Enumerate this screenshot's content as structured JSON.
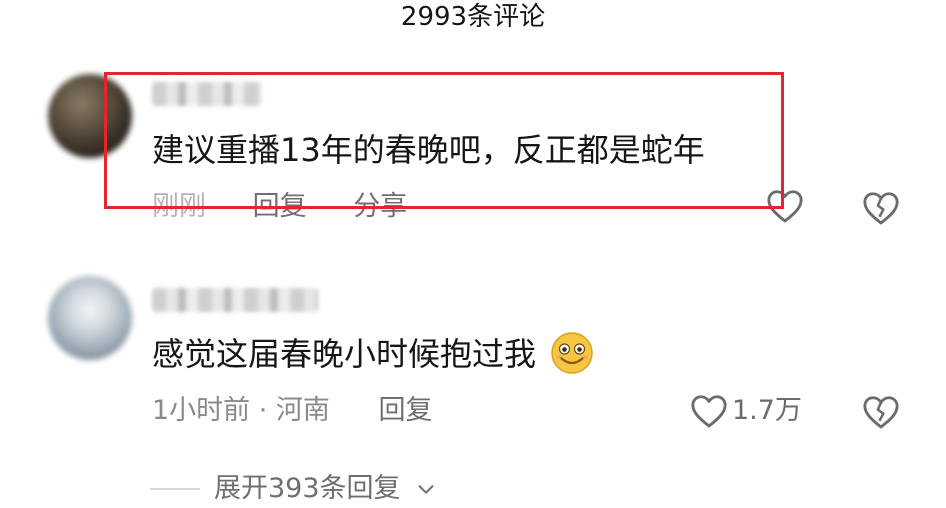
{
  "header": {
    "comment_count_title": "2993条评论"
  },
  "comments": [
    {
      "text": "建议重播13年的春晚吧，反正都是蛇年",
      "time": "刚刚",
      "reply_label": "回复",
      "share_label": "分享",
      "like_count": "",
      "highlighted": true
    },
    {
      "text": "感觉这届春晚小时候抱过我",
      "emoji": "smiley-emoji",
      "time_location": "1小时前 · 河南",
      "reply_label": "回复",
      "like_count": "1.7万"
    }
  ],
  "expand_replies": {
    "label": "展开393条回复",
    "icon": "chevron-down-icon"
  },
  "colors": {
    "highlight": "#e4262a",
    "meta_text": "#8a8a8a",
    "text": "#161616"
  }
}
